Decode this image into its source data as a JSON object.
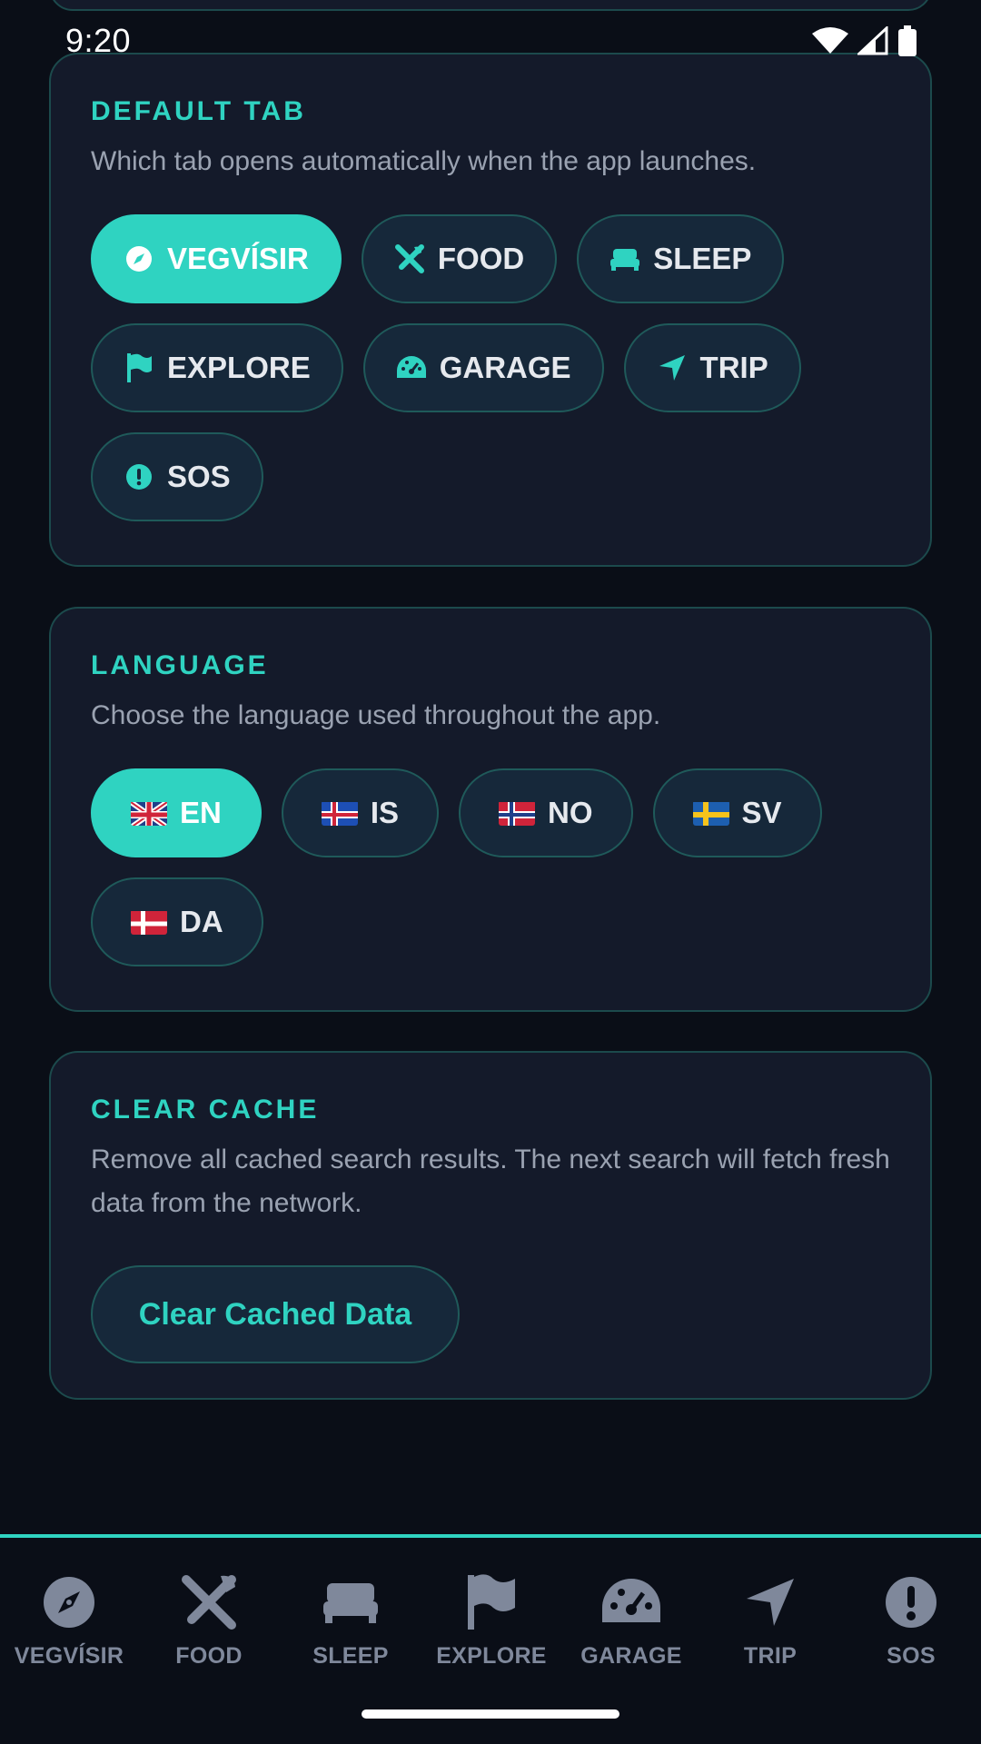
{
  "status": {
    "time": "9:20"
  },
  "default_tab": {
    "title": "DEFAULT TAB",
    "description": "Which tab opens automatically when the app launches.",
    "options": [
      {
        "label": "VEGVÍSIR",
        "icon": "compass-icon",
        "active": true
      },
      {
        "label": "FOOD",
        "icon": "utensils-icon",
        "active": false
      },
      {
        "label": "SLEEP",
        "icon": "bed-icon",
        "active": false
      },
      {
        "label": "EXPLORE",
        "icon": "flag-icon",
        "active": false
      },
      {
        "label": "GARAGE",
        "icon": "gauge-icon",
        "active": false
      },
      {
        "label": "TRIP",
        "icon": "location-arrow-icon",
        "active": false
      },
      {
        "label": "SOS",
        "icon": "exclamation-icon",
        "active": false
      }
    ]
  },
  "language": {
    "title": "LANGUAGE",
    "description": "Choose the language used throughout the app.",
    "options": [
      {
        "label": "EN",
        "flag": "uk-flag-icon",
        "active": true
      },
      {
        "label": "IS",
        "flag": "iceland-flag-icon",
        "active": false
      },
      {
        "label": "NO",
        "flag": "norway-flag-icon",
        "active": false
      },
      {
        "label": "SV",
        "flag": "sweden-flag-icon",
        "active": false
      },
      {
        "label": "DA",
        "flag": "denmark-flag-icon",
        "active": false
      }
    ]
  },
  "clear_cache": {
    "title": "CLEAR CACHE",
    "description": "Remove all cached search results. The next search will fetch fresh data from the network.",
    "button_label": "Clear Cached Data"
  },
  "bottom_nav": {
    "items": [
      {
        "label": "VEGVÍSIR",
        "icon": "compass-icon"
      },
      {
        "label": "FOOD",
        "icon": "utensils-icon"
      },
      {
        "label": "SLEEP",
        "icon": "bed-icon"
      },
      {
        "label": "EXPLORE",
        "icon": "flag-icon"
      },
      {
        "label": "GARAGE",
        "icon": "gauge-icon"
      },
      {
        "label": "TRIP",
        "icon": "location-arrow-icon"
      },
      {
        "label": "SOS",
        "icon": "exclamation-icon"
      }
    ]
  },
  "colors": {
    "accent": "#2fd3c1",
    "background": "#0a0e17",
    "card": "#141a2a",
    "nav_inactive": "#7f889b"
  }
}
